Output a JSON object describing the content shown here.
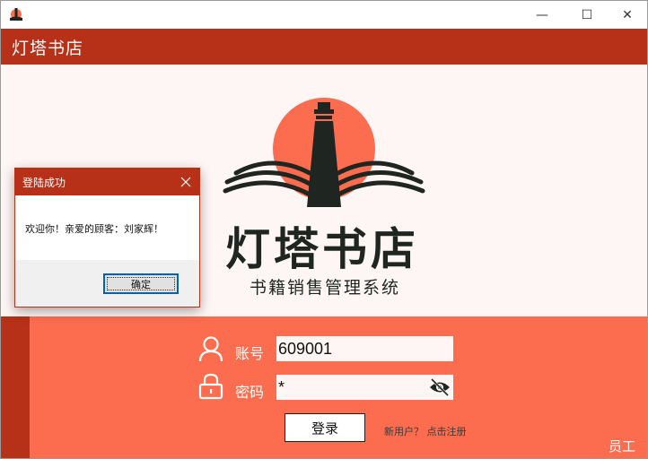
{
  "window": {
    "minimize_glyph": "—",
    "maximize_glyph": "☐",
    "close_glyph": "✕"
  },
  "app": {
    "title": "灯塔书店"
  },
  "logo": {
    "name": "灯塔书店",
    "subtitle": "书籍销售管理系统",
    "icon": "lighthouse-logo"
  },
  "login": {
    "account_label": "账号",
    "account_value": "609001",
    "password_label": "密码",
    "password_value": "*",
    "login_button": "登录",
    "register_link": "新用户？ 点击注册",
    "role_label": "员工"
  },
  "dialog": {
    "title": "登陆成功",
    "message": "欢迎你！亲爱的顾客：刘家辉！",
    "ok_button": "确定"
  },
  "colors": {
    "header_red": "#b63118",
    "panel_orange": "#fc6c4e",
    "logo_bg": "#fdf6f4",
    "dark": "#1f2520",
    "sun": "#fc6c4e"
  }
}
